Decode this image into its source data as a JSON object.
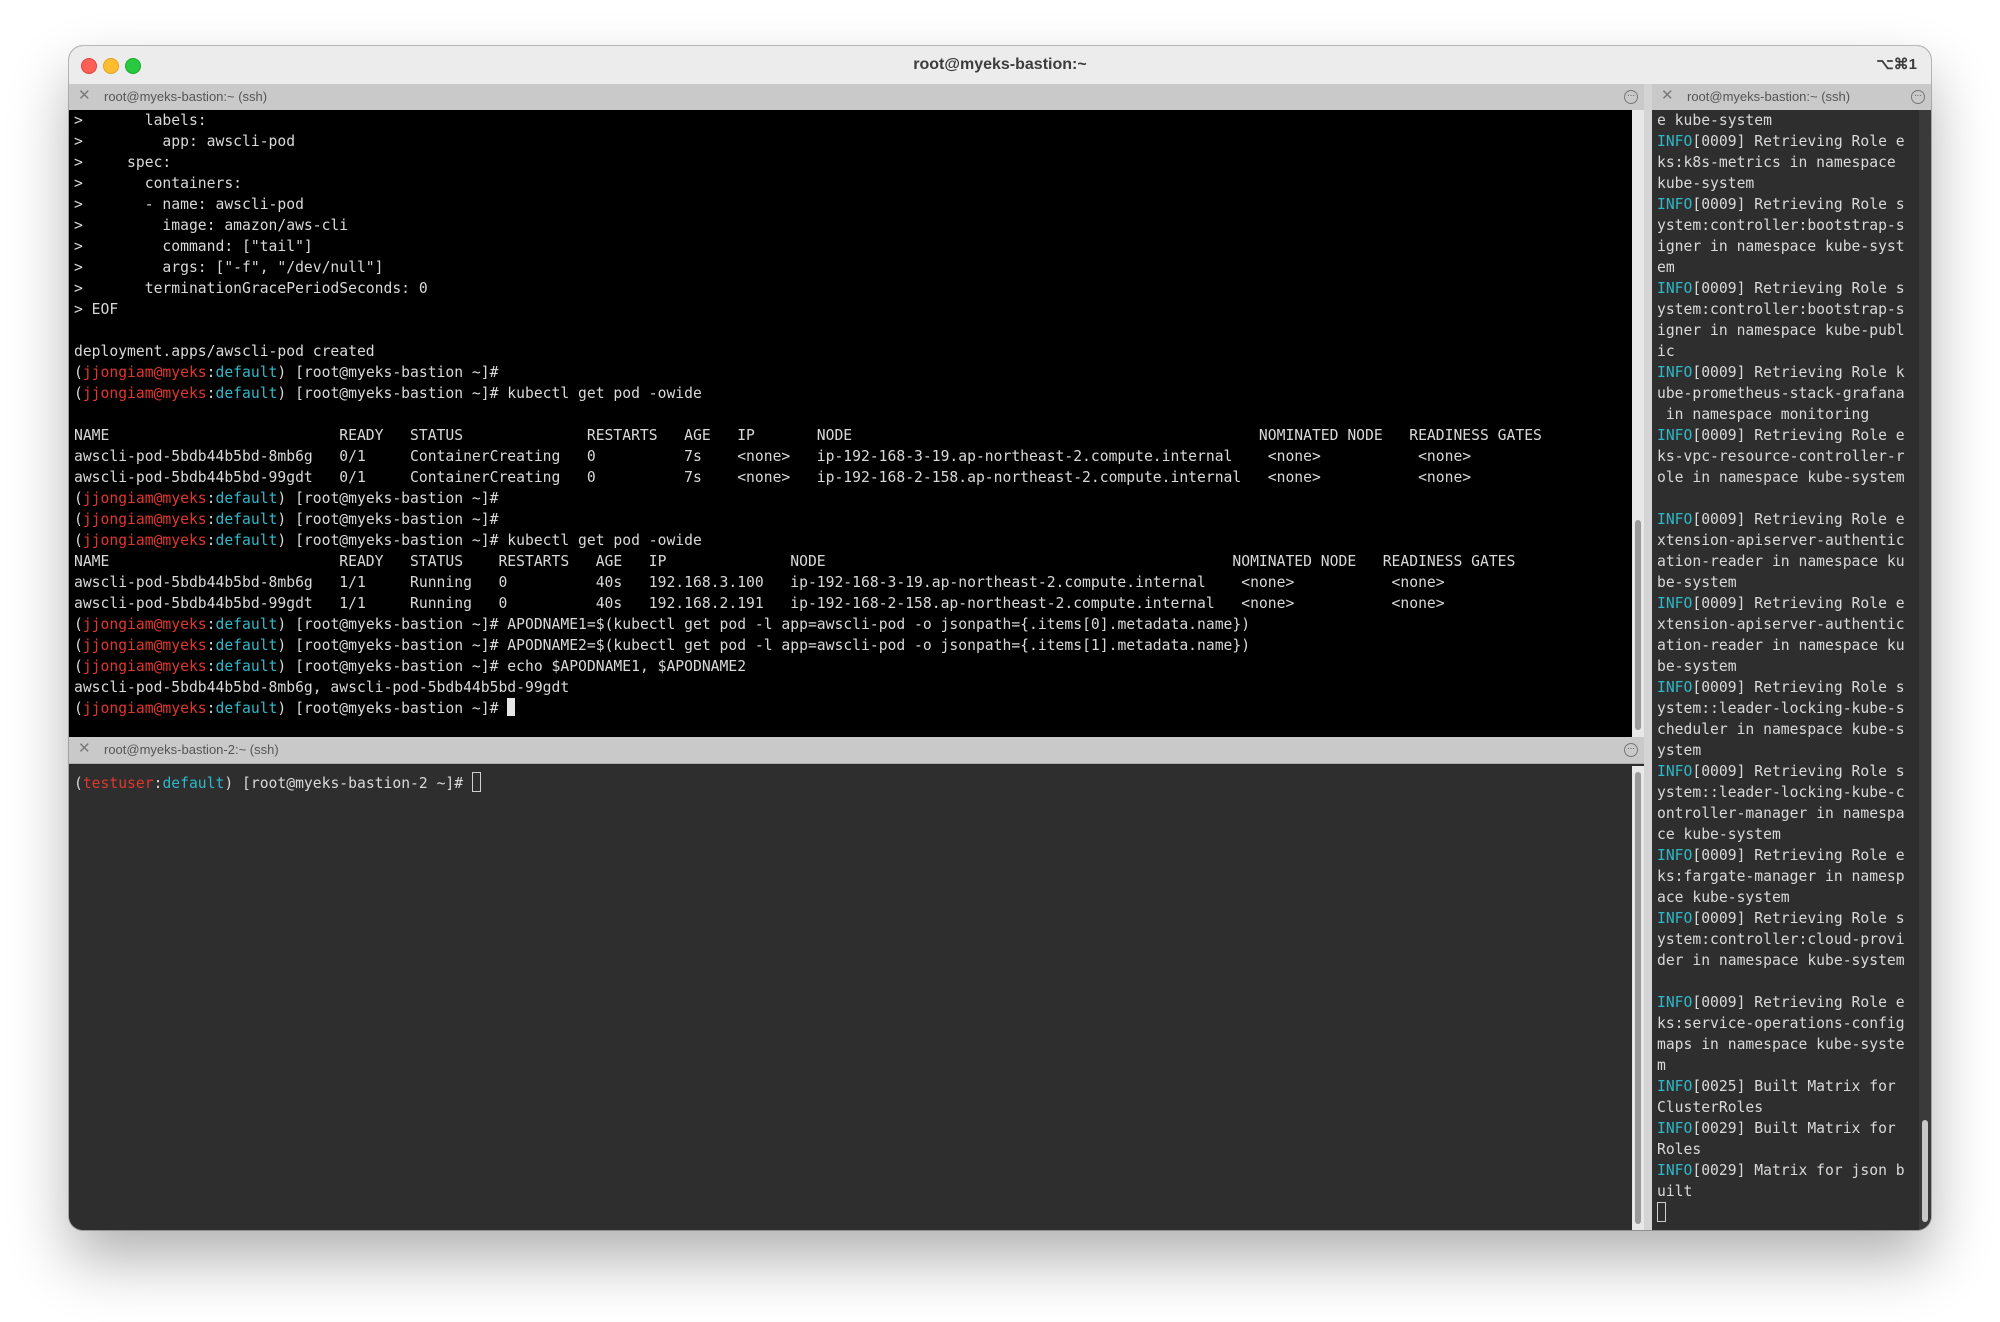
{
  "window": {
    "title": "root@myeks-bastion:~",
    "shortcut": "⌥⌘1"
  },
  "panes": {
    "main": {
      "tab_title": "root@myeks-bastion:~ (ssh)",
      "lines": [
        [
          {
            "t": ">       labels:"
          }
        ],
        [
          {
            "t": ">         app: awscli-pod"
          }
        ],
        [
          {
            "t": ">     spec:"
          }
        ],
        [
          {
            "t": ">       containers:"
          }
        ],
        [
          {
            "t": ">       - name: awscli-pod"
          }
        ],
        [
          {
            "t": ">         image: amazon/aws-cli"
          }
        ],
        [
          {
            "t": ">         command: [\"tail\"]"
          }
        ],
        [
          {
            "t": ">         args: [\"-f\", \"/dev/null\"]"
          }
        ],
        [
          {
            "t": ">       terminationGracePeriodSeconds: 0"
          }
        ],
        [
          {
            "t": "> EOF"
          }
        ],
        [
          {
            "t": ""
          }
        ],
        [
          {
            "t": "deployment.apps/awscli-pod created"
          }
        ],
        [
          {
            "t": "("
          },
          {
            "t": "jjongiam@myeks",
            "c": "red"
          },
          {
            "t": ":"
          },
          {
            "t": "default",
            "c": "cyan"
          },
          {
            "t": ") [root@myeks-bastion ~]#"
          }
        ],
        [
          {
            "t": "("
          },
          {
            "t": "jjongiam@myeks",
            "c": "red"
          },
          {
            "t": ":"
          },
          {
            "t": "default",
            "c": "cyan"
          },
          {
            "t": ") [root@myeks-bastion ~]# kubectl get pod -owide"
          }
        ],
        [
          {
            "t": ""
          }
        ],
        [
          {
            "t": "NAME                          READY   STATUS              RESTARTS   AGE   IP       NODE                                              NOMINATED NODE   READINESS GATES"
          }
        ],
        [
          {
            "t": "awscli-pod-5bdb44b5bd-8mb6g   0/1     ContainerCreating   0          7s    <none>   ip-192-168-3-19.ap-northeast-2.compute.internal    <none>           <none>"
          }
        ],
        [
          {
            "t": "awscli-pod-5bdb44b5bd-99gdt   0/1     ContainerCreating   0          7s    <none>   ip-192-168-2-158.ap-northeast-2.compute.internal   <none>           <none>"
          }
        ],
        [
          {
            "t": "("
          },
          {
            "t": "jjongiam@myeks",
            "c": "red"
          },
          {
            "t": ":"
          },
          {
            "t": "default",
            "c": "cyan"
          },
          {
            "t": ") [root@myeks-bastion ~]#"
          }
        ],
        [
          {
            "t": "("
          },
          {
            "t": "jjongiam@myeks",
            "c": "red"
          },
          {
            "t": ":"
          },
          {
            "t": "default",
            "c": "cyan"
          },
          {
            "t": ") [root@myeks-bastion ~]#"
          }
        ],
        [
          {
            "t": "("
          },
          {
            "t": "jjongiam@myeks",
            "c": "red"
          },
          {
            "t": ":"
          },
          {
            "t": "default",
            "c": "cyan"
          },
          {
            "t": ") [root@myeks-bastion ~]# kubectl get pod -owide"
          }
        ],
        [
          {
            "t": "NAME                          READY   STATUS    RESTARTS   AGE   IP              NODE                                              NOMINATED NODE   READINESS GATES"
          }
        ],
        [
          {
            "t": "awscli-pod-5bdb44b5bd-8mb6g   1/1     Running   0          40s   192.168.3.100   ip-192-168-3-19.ap-northeast-2.compute.internal    <none>           <none>"
          }
        ],
        [
          {
            "t": "awscli-pod-5bdb44b5bd-99gdt   1/1     Running   0          40s   192.168.2.191   ip-192-168-2-158.ap-northeast-2.compute.internal   <none>           <none>"
          }
        ],
        [
          {
            "t": "("
          },
          {
            "t": "jjongiam@myeks",
            "c": "red"
          },
          {
            "t": ":"
          },
          {
            "t": "default",
            "c": "cyan"
          },
          {
            "t": ") [root@myeks-bastion ~]# APODNAME1=$(kubectl get pod -l app=awscli-pod -o jsonpath={.items[0].metadata.name})"
          }
        ],
        [
          {
            "t": "("
          },
          {
            "t": "jjongiam@myeks",
            "c": "red"
          },
          {
            "t": ":"
          },
          {
            "t": "default",
            "c": "cyan"
          },
          {
            "t": ") [root@myeks-bastion ~]# APODNAME2=$(kubectl get pod -l app=awscli-pod -o jsonpath={.items[1].metadata.name})"
          }
        ],
        [
          {
            "t": "("
          },
          {
            "t": "jjongiam@myeks",
            "c": "red"
          },
          {
            "t": ":"
          },
          {
            "t": "default",
            "c": "cyan"
          },
          {
            "t": ") [root@myeks-bastion ~]# echo $APODNAME1, $APODNAME2"
          }
        ],
        [
          {
            "t": "awscli-pod-5bdb44b5bd-8mb6g, awscli-pod-5bdb44b5bd-99gdt"
          }
        ],
        [
          {
            "t": "("
          },
          {
            "t": "jjongiam@myeks",
            "c": "red"
          },
          {
            "t": ":"
          },
          {
            "t": "default",
            "c": "cyan"
          },
          {
            "t": ") [root@myeks-bastion ~]# "
          },
          {
            "cursor": "block"
          }
        ]
      ]
    },
    "bottom": {
      "tab_title": "root@myeks-bastion-2:~ (ssh)",
      "lines": [
        [
          {
            "t": "("
          },
          {
            "t": "testuser",
            "c": "red"
          },
          {
            "t": ":"
          },
          {
            "t": "default",
            "c": "cyan"
          },
          {
            "t": ") [root@myeks-bastion-2 ~]# "
          },
          {
            "cursor": "hollow"
          }
        ]
      ]
    },
    "right": {
      "tab_title": "root@myeks-bastion:~ (ssh)",
      "lines": [
        [
          {
            "t": "e kube-system"
          }
        ],
        [
          {
            "t": "INFO",
            "c": "cyan"
          },
          {
            "t": "[0009] Retrieving Role e"
          }
        ],
        [
          {
            "t": "ks:k8s-metrics in namespace"
          }
        ],
        [
          {
            "t": "kube-system"
          }
        ],
        [
          {
            "t": "INFO",
            "c": "cyan"
          },
          {
            "t": "[0009] Retrieving Role s"
          }
        ],
        [
          {
            "t": "ystem:controller:bootstrap-s"
          }
        ],
        [
          {
            "t": "igner in namespace kube-syst"
          }
        ],
        [
          {
            "t": "em"
          }
        ],
        [
          {
            "t": "INFO",
            "c": "cyan"
          },
          {
            "t": "[0009] Retrieving Role s"
          }
        ],
        [
          {
            "t": "ystem:controller:bootstrap-s"
          }
        ],
        [
          {
            "t": "igner in namespace kube-publ"
          }
        ],
        [
          {
            "t": "ic"
          }
        ],
        [
          {
            "t": "INFO",
            "c": "cyan"
          },
          {
            "t": "[0009] Retrieving Role k"
          }
        ],
        [
          {
            "t": "ube-prometheus-stack-grafana"
          }
        ],
        [
          {
            "t": " in namespace monitoring"
          }
        ],
        [
          {
            "t": "INFO",
            "c": "cyan"
          },
          {
            "t": "[0009] Retrieving Role e"
          }
        ],
        [
          {
            "t": "ks-vpc-resource-controller-r"
          }
        ],
        [
          {
            "t": "ole in namespace kube-system"
          }
        ],
        [
          {
            "t": ""
          }
        ],
        [
          {
            "t": "INFO",
            "c": "cyan"
          },
          {
            "t": "[0009] Retrieving Role e"
          }
        ],
        [
          {
            "t": "xtension-apiserver-authentic"
          }
        ],
        [
          {
            "t": "ation-reader in namespace ku"
          }
        ],
        [
          {
            "t": "be-system"
          }
        ],
        [
          {
            "t": "INFO",
            "c": "cyan"
          },
          {
            "t": "[0009] Retrieving Role e"
          }
        ],
        [
          {
            "t": "xtension-apiserver-authentic"
          }
        ],
        [
          {
            "t": "ation-reader in namespace ku"
          }
        ],
        [
          {
            "t": "be-system"
          }
        ],
        [
          {
            "t": "INFO",
            "c": "cyan"
          },
          {
            "t": "[0009] Retrieving Role s"
          }
        ],
        [
          {
            "t": "ystem::leader-locking-kube-s"
          }
        ],
        [
          {
            "t": "cheduler in namespace kube-s"
          }
        ],
        [
          {
            "t": "ystem"
          }
        ],
        [
          {
            "t": "INFO",
            "c": "cyan"
          },
          {
            "t": "[0009] Retrieving Role s"
          }
        ],
        [
          {
            "t": "ystem::leader-locking-kube-c"
          }
        ],
        [
          {
            "t": "ontroller-manager in namespa"
          }
        ],
        [
          {
            "t": "ce kube-system"
          }
        ],
        [
          {
            "t": "INFO",
            "c": "cyan"
          },
          {
            "t": "[0009] Retrieving Role e"
          }
        ],
        [
          {
            "t": "ks:fargate-manager in namesp"
          }
        ],
        [
          {
            "t": "ace kube-system"
          }
        ],
        [
          {
            "t": "INFO",
            "c": "cyan"
          },
          {
            "t": "[0009] Retrieving Role s"
          }
        ],
        [
          {
            "t": "ystem:controller:cloud-provi"
          }
        ],
        [
          {
            "t": "der in namespace kube-system"
          }
        ],
        [
          {
            "t": ""
          }
        ],
        [
          {
            "t": "INFO",
            "c": "cyan"
          },
          {
            "t": "[0009] Retrieving Role e"
          }
        ],
        [
          {
            "t": "ks:service-operations-config"
          }
        ],
        [
          {
            "t": "maps in namespace kube-syste"
          }
        ],
        [
          {
            "t": "m"
          }
        ],
        [
          {
            "t": "INFO",
            "c": "cyan"
          },
          {
            "t": "[0025] Built Matrix for"
          }
        ],
        [
          {
            "t": "ClusterRoles"
          }
        ],
        [
          {
            "t": "INFO",
            "c": "cyan"
          },
          {
            "t": "[0029] Built Matrix for"
          }
        ],
        [
          {
            "t": "Roles"
          }
        ],
        [
          {
            "t": "INFO",
            "c": "cyan"
          },
          {
            "t": "[0029] Matrix for json b"
          }
        ],
        [
          {
            "t": "uilt"
          }
        ],
        [
          {
            "cursor": "hollow"
          }
        ]
      ]
    }
  },
  "colors": {
    "prompt_user": "#e0372c",
    "prompt_context": "#2fb8c9",
    "terminal_text": "#d9d9d9",
    "pane_active_bg": "#000000",
    "pane_inactive_bg": "#2e2e2e"
  },
  "icons": {
    "tab_close": "close-icon",
    "tab_menu": "pane-menu-icon"
  }
}
